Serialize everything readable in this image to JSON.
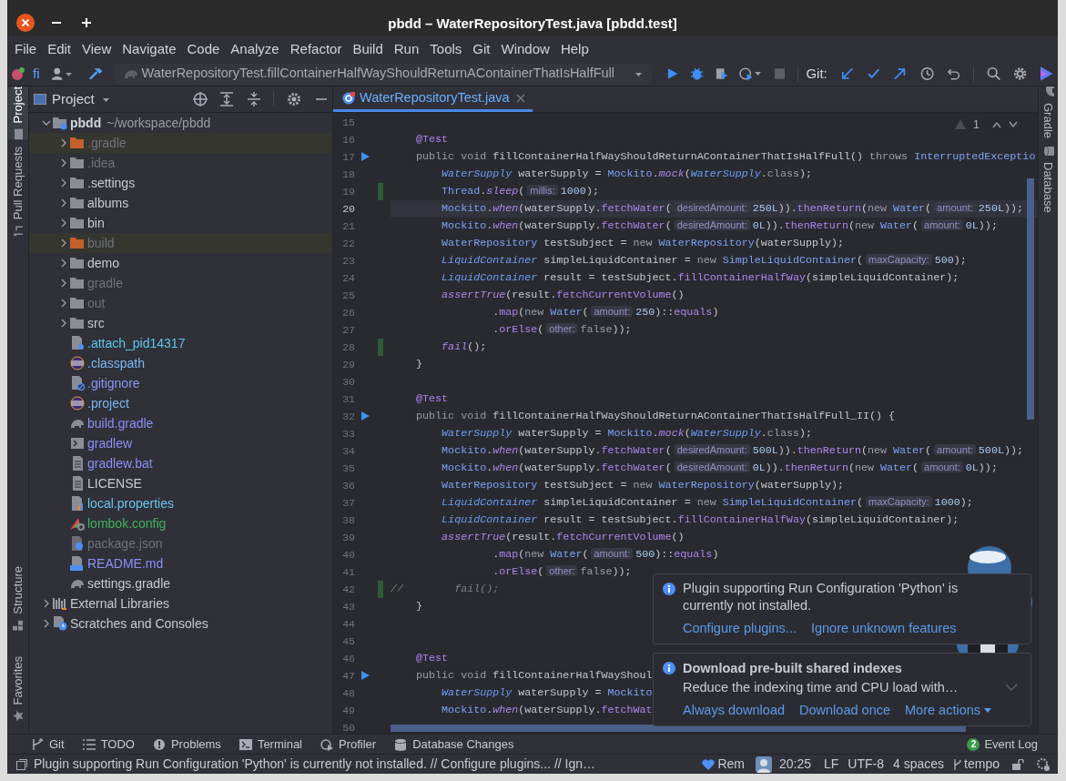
{
  "window": {
    "title": "pbdd – WaterRepositoryTest.java [pbdd.test]"
  },
  "menu": [
    "File",
    "Edit",
    "View",
    "Navigate",
    "Code",
    "Analyze",
    "Refactor",
    "Build",
    "Run",
    "Tools",
    "Git",
    "Window",
    "Help"
  ],
  "toolbar": {
    "vcs_label": "fi",
    "run_config": "WaterRepositoryTest.fillContainerHalfWayShouldReturnAContainerThatIsHalfFull",
    "git_label": "Git:"
  },
  "left_stripe": [
    {
      "label": "Project",
      "selected": true,
      "kind": "project"
    },
    {
      "label": "Pull Requests",
      "selected": false,
      "kind": "pull"
    },
    {
      "label": "Structure",
      "selected": false,
      "kind": "structure"
    },
    {
      "label": "Favorites",
      "selected": false,
      "kind": "favorites"
    }
  ],
  "right_stripe": [
    {
      "label": "Gradle",
      "kind": "gradle"
    },
    {
      "label": "Database",
      "kind": "database"
    }
  ],
  "project_panel": {
    "title": "Project",
    "tree": [
      {
        "kind": "module",
        "label": "pbdd",
        "path": "~/workspace/pbdd",
        "expanded": true,
        "children": [
          {
            "kind": "folder",
            "label": ".gradle",
            "expanded": false,
            "excluded": true,
            "color": "#6f727c"
          },
          {
            "kind": "folder",
            "label": ".idea",
            "expanded": false,
            "excluded": false,
            "color": "#6f727c"
          },
          {
            "kind": "folder",
            "label": ".settings",
            "expanded": false,
            "excluded": false,
            "color": "#c9cbd2"
          },
          {
            "kind": "folder",
            "label": "albums",
            "expanded": false,
            "excluded": false,
            "color": "#c9cbd2"
          },
          {
            "kind": "folder",
            "label": "bin",
            "expanded": false,
            "excluded": false,
            "color": "#c9cbd2"
          },
          {
            "kind": "folder",
            "label": "build",
            "expanded": false,
            "excluded": true,
            "color": "#6f727c"
          },
          {
            "kind": "folder",
            "label": "demo",
            "expanded": false,
            "excluded": false,
            "color": "#c9cbd2"
          },
          {
            "kind": "folder",
            "label": "gradle",
            "expanded": false,
            "excluded": false,
            "color": "#6f727c"
          },
          {
            "kind": "folder",
            "label": "out",
            "expanded": false,
            "excluded": false,
            "color": "#6f727c"
          },
          {
            "kind": "folder",
            "label": "src",
            "expanded": false,
            "excluded": false,
            "color": "#c9cbd2"
          },
          {
            "kind": "unknown",
            "label": ".attach_pid14317",
            "excluded": false,
            "color": "#5ec8ee"
          },
          {
            "kind": "eclipse",
            "label": ".classpath",
            "excluded": false,
            "color": "#7ab8f0"
          },
          {
            "kind": "ignore",
            "label": ".gitignore",
            "excluded": false,
            "color": "#8a98f2"
          },
          {
            "kind": "eclipse",
            "label": ".project",
            "excluded": false,
            "color": "#7ab8f0"
          },
          {
            "kind": "gradle",
            "label": "build.gradle",
            "excluded": false,
            "color": "#8c8ff5"
          },
          {
            "kind": "script",
            "label": "gradlew",
            "excluded": false,
            "color": "#8c8ff5"
          },
          {
            "kind": "text",
            "label": "gradlew.bat",
            "excluded": false,
            "color": "#8c8ff5"
          },
          {
            "kind": "text",
            "label": "LICENSE",
            "excluded": false,
            "color": "#c9cbd2"
          },
          {
            "kind": "properties",
            "label": "local.properties",
            "excluded": false,
            "color": "#6cc4f0"
          },
          {
            "kind": "config",
            "label": "lombok.config",
            "excluded": false,
            "color": "#43b05c"
          },
          {
            "kind": "json",
            "label": "package.json",
            "excluded": false,
            "color": "#6f727c"
          },
          {
            "kind": "markdown",
            "label": "README.md",
            "excluded": false,
            "color": "#8c8ff5"
          },
          {
            "kind": "gradle",
            "label": "settings.gradle",
            "excluded": false,
            "color": "#c9cbd2"
          }
        ]
      },
      {
        "kind": "libraries",
        "label": "External Libraries",
        "expanded": false
      },
      {
        "kind": "scratches",
        "label": "Scratches and Consoles",
        "expanded": false
      }
    ]
  },
  "editor": {
    "tabs": [
      {
        "label": "WaterRepositoryTest.java",
        "selected": true
      }
    ],
    "problems_count": "1",
    "lines": [
      {
        "number": "15",
        "current": false,
        "runnable": false,
        "changed": false
      },
      {
        "number": "16",
        "current": false,
        "runnable": false,
        "changed": false,
        "tokens": [
          {
            "kind": "ann",
            "text": "    @Test"
          }
        ]
      },
      {
        "number": "17",
        "current": false,
        "runnable": true,
        "changed": false,
        "tokens": [
          {
            "kind": "kw",
            "text": "    public void "
          },
          {
            "kind": "plain",
            "text": "fillContainerHalfWayShouldReturnAContainerThatIsHalfFull() "
          },
          {
            "kind": "kw",
            "text": "throws "
          },
          {
            "kind": "type",
            "text": "InterruptedExceptio"
          }
        ]
      },
      {
        "number": "18",
        "current": false,
        "runnable": false,
        "changed": false,
        "tokens": [
          {
            "kind": "itype",
            "text": "        WaterSupply"
          },
          {
            "kind": "plain",
            "text": " waterSupply = "
          },
          {
            "kind": "type",
            "text": "Mockito"
          },
          {
            "kind": "plain",
            "text": "."
          },
          {
            "kind": "icall",
            "text": "mock"
          },
          {
            "kind": "plain",
            "text": "("
          },
          {
            "kind": "itype",
            "text": "WaterSupply"
          },
          {
            "kind": "plain",
            "text": "."
          },
          {
            "kind": "kw",
            "text": "class"
          },
          {
            "kind": "plain",
            "text": ");"
          }
        ]
      },
      {
        "number": "19",
        "current": false,
        "runnable": false,
        "changed": true,
        "tokens": [
          {
            "kind": "type",
            "text": "        Thread"
          },
          {
            "kind": "plain",
            "text": "."
          },
          {
            "kind": "icall",
            "text": "sleep"
          },
          {
            "kind": "plain",
            "text": "("
          },
          {
            "kind": "hint",
            "text": "millis:"
          },
          {
            "kind": "num",
            "text": "1000"
          },
          {
            "kind": "plain",
            "text": ");"
          }
        ]
      },
      {
        "number": "20",
        "current": true,
        "runnable": false,
        "changed": false,
        "tokens": [
          {
            "kind": "type",
            "text": "        Mockito"
          },
          {
            "kind": "plain",
            "text": "."
          },
          {
            "kind": "icall",
            "text": "when"
          },
          {
            "kind": "plain",
            "text": "(waterSupply."
          },
          {
            "kind": "call",
            "text": "fetchWater"
          },
          {
            "kind": "plain",
            "text": "("
          },
          {
            "kind": "hint",
            "text": "desiredAmount:"
          },
          {
            "kind": "num",
            "text": "250L"
          },
          {
            "kind": "plain",
            "text": "))."
          },
          {
            "kind": "call",
            "text": "thenReturn"
          },
          {
            "kind": "plain",
            "text": "("
          },
          {
            "kind": "kw",
            "text": "new "
          },
          {
            "kind": "type",
            "text": "Water"
          },
          {
            "kind": "plain",
            "text": "("
          },
          {
            "kind": "hint",
            "text": "amount:"
          },
          {
            "kind": "num",
            "text": "250L"
          },
          {
            "kind": "plain",
            "text": "));"
          }
        ]
      },
      {
        "number": "21",
        "current": false,
        "runnable": false,
        "changed": false,
        "tokens": [
          {
            "kind": "type",
            "text": "        Mockito"
          },
          {
            "kind": "plain",
            "text": "."
          },
          {
            "kind": "icall",
            "text": "when"
          },
          {
            "kind": "plain",
            "text": "(waterSupply."
          },
          {
            "kind": "call",
            "text": "fetchWater"
          },
          {
            "kind": "plain",
            "text": "("
          },
          {
            "kind": "hint",
            "text": "desiredAmount:"
          },
          {
            "kind": "num",
            "text": "0L"
          },
          {
            "kind": "plain",
            "text": "))."
          },
          {
            "kind": "call",
            "text": "thenReturn"
          },
          {
            "kind": "plain",
            "text": "("
          },
          {
            "kind": "kw",
            "text": "new "
          },
          {
            "kind": "type",
            "text": "Water"
          },
          {
            "kind": "plain",
            "text": "("
          },
          {
            "kind": "hint",
            "text": "amount:"
          },
          {
            "kind": "num",
            "text": "0L"
          },
          {
            "kind": "plain",
            "text": "));"
          }
        ]
      },
      {
        "number": "22",
        "current": false,
        "runnable": false,
        "changed": false,
        "tokens": [
          {
            "kind": "type",
            "text": "        WaterRepository"
          },
          {
            "kind": "plain",
            "text": " testSubject = "
          },
          {
            "kind": "kw",
            "text": "new "
          },
          {
            "kind": "type",
            "text": "WaterRepository"
          },
          {
            "kind": "plain",
            "text": "(waterSupply);"
          }
        ]
      },
      {
        "number": "23",
        "current": false,
        "runnable": false,
        "changed": false,
        "tokens": [
          {
            "kind": "itype",
            "text": "        LiquidContainer"
          },
          {
            "kind": "plain",
            "text": " simpleLiquidContainer = "
          },
          {
            "kind": "kw",
            "text": "new "
          },
          {
            "kind": "type",
            "text": "SimpleLiquidContainer"
          },
          {
            "kind": "plain",
            "text": "("
          },
          {
            "kind": "hint",
            "text": "maxCapacity:"
          },
          {
            "kind": "num",
            "text": "500"
          },
          {
            "kind": "plain",
            "text": ");"
          }
        ]
      },
      {
        "number": "24",
        "current": false,
        "runnable": false,
        "changed": false,
        "tokens": [
          {
            "kind": "itype",
            "text": "        LiquidContainer"
          },
          {
            "kind": "plain",
            "text": " result = testSubject."
          },
          {
            "kind": "call",
            "text": "fillContainerHalfWay"
          },
          {
            "kind": "plain",
            "text": "(simpleLiquidContainer);"
          }
        ]
      },
      {
        "number": "25",
        "current": false,
        "runnable": false,
        "changed": false,
        "tokens": [
          {
            "kind": "icall",
            "text": "        assertTrue"
          },
          {
            "kind": "plain",
            "text": "(result."
          },
          {
            "kind": "call",
            "text": "fetchCurrentVolume"
          },
          {
            "kind": "plain",
            "text": "()"
          }
        ]
      },
      {
        "number": "26",
        "current": false,
        "runnable": false,
        "changed": false,
        "tokens": [
          {
            "kind": "plain",
            "text": "                ."
          },
          {
            "kind": "call",
            "text": "map"
          },
          {
            "kind": "plain",
            "text": "("
          },
          {
            "kind": "kw",
            "text": "new "
          },
          {
            "kind": "type",
            "text": "Water"
          },
          {
            "kind": "plain",
            "text": "("
          },
          {
            "kind": "hint",
            "text": "amount:"
          },
          {
            "kind": "num",
            "text": "250"
          },
          {
            "kind": "plain",
            "text": ")::"
          },
          {
            "kind": "call",
            "text": "equals"
          },
          {
            "kind": "plain",
            "text": ")"
          }
        ]
      },
      {
        "number": "27",
        "current": false,
        "runnable": false,
        "changed": false,
        "tokens": [
          {
            "kind": "plain",
            "text": "                ."
          },
          {
            "kind": "call",
            "text": "orElse"
          },
          {
            "kind": "plain",
            "text": "("
          },
          {
            "kind": "hint",
            "text": "other:"
          },
          {
            "kind": "kw",
            "text": "false"
          },
          {
            "kind": "plain",
            "text": "));"
          }
        ]
      },
      {
        "number": "28",
        "current": false,
        "runnable": false,
        "changed": true,
        "tokens": [
          {
            "kind": "icall",
            "text": "        fail"
          },
          {
            "kind": "plain",
            "text": "();"
          }
        ]
      },
      {
        "number": "29",
        "current": false,
        "runnable": false,
        "changed": false,
        "tokens": [
          {
            "kind": "plain",
            "text": "    }"
          }
        ]
      },
      {
        "number": "30",
        "current": false,
        "runnable": false,
        "changed": false
      },
      {
        "number": "31",
        "current": false,
        "runnable": false,
        "changed": false,
        "tokens": [
          {
            "kind": "ann",
            "text": "    @Test"
          }
        ]
      },
      {
        "number": "32",
        "current": false,
        "runnable": true,
        "changed": false,
        "tokens": [
          {
            "kind": "kw",
            "text": "    public void "
          },
          {
            "kind": "plain",
            "text": "fillContainerHalfWayShouldReturnAContainerThatIsHalfFull_II() {"
          }
        ]
      },
      {
        "number": "33",
        "current": false,
        "runnable": false,
        "changed": false,
        "tokens": [
          {
            "kind": "itype",
            "text": "        WaterSupply"
          },
          {
            "kind": "plain",
            "text": " waterSupply = "
          },
          {
            "kind": "type",
            "text": "Mockito"
          },
          {
            "kind": "plain",
            "text": "."
          },
          {
            "kind": "icall",
            "text": "mock"
          },
          {
            "kind": "plain",
            "text": "("
          },
          {
            "kind": "itype",
            "text": "WaterSupply"
          },
          {
            "kind": "plain",
            "text": "."
          },
          {
            "kind": "kw",
            "text": "class"
          },
          {
            "kind": "plain",
            "text": ");"
          }
        ]
      },
      {
        "number": "34",
        "current": false,
        "runnable": false,
        "changed": false,
        "tokens": [
          {
            "kind": "type",
            "text": "        Mockito"
          },
          {
            "kind": "plain",
            "text": "."
          },
          {
            "kind": "icall",
            "text": "when"
          },
          {
            "kind": "plain",
            "text": "(waterSupply."
          },
          {
            "kind": "call",
            "text": "fetchWater"
          },
          {
            "kind": "plain",
            "text": "("
          },
          {
            "kind": "hint",
            "text": "desiredAmount:"
          },
          {
            "kind": "num",
            "text": "500L"
          },
          {
            "kind": "plain",
            "text": "))."
          },
          {
            "kind": "call",
            "text": "thenReturn"
          },
          {
            "kind": "plain",
            "text": "("
          },
          {
            "kind": "kw",
            "text": "new "
          },
          {
            "kind": "type",
            "text": "Water"
          },
          {
            "kind": "plain",
            "text": "("
          },
          {
            "kind": "hint",
            "text": "amount:"
          },
          {
            "kind": "num",
            "text": "500L"
          },
          {
            "kind": "plain",
            "text": "));"
          }
        ]
      },
      {
        "number": "35",
        "current": false,
        "runnable": false,
        "changed": false,
        "tokens": [
          {
            "kind": "type",
            "text": "        Mockito"
          },
          {
            "kind": "plain",
            "text": "."
          },
          {
            "kind": "icall",
            "text": "when"
          },
          {
            "kind": "plain",
            "text": "(waterSupply."
          },
          {
            "kind": "call",
            "text": "fetchWater"
          },
          {
            "kind": "plain",
            "text": "("
          },
          {
            "kind": "hint",
            "text": "desiredAmount:"
          },
          {
            "kind": "num",
            "text": "0L"
          },
          {
            "kind": "plain",
            "text": "))."
          },
          {
            "kind": "call",
            "text": "thenReturn"
          },
          {
            "kind": "plain",
            "text": "("
          },
          {
            "kind": "kw",
            "text": "new "
          },
          {
            "kind": "type",
            "text": "Water"
          },
          {
            "kind": "plain",
            "text": "("
          },
          {
            "kind": "hint",
            "text": "amount:"
          },
          {
            "kind": "num",
            "text": "0L"
          },
          {
            "kind": "plain",
            "text": "));"
          }
        ]
      },
      {
        "number": "36",
        "current": false,
        "runnable": false,
        "changed": false,
        "tokens": [
          {
            "kind": "type",
            "text": "        WaterRepository"
          },
          {
            "kind": "plain",
            "text": " testSubject = "
          },
          {
            "kind": "kw",
            "text": "new "
          },
          {
            "kind": "type",
            "text": "WaterRepository"
          },
          {
            "kind": "plain",
            "text": "(waterSupply);"
          }
        ]
      },
      {
        "number": "37",
        "current": false,
        "runnable": false,
        "changed": false,
        "tokens": [
          {
            "kind": "itype",
            "text": "        LiquidContainer"
          },
          {
            "kind": "plain",
            "text": " simpleLiquidContainer = "
          },
          {
            "kind": "kw",
            "text": "new "
          },
          {
            "kind": "type",
            "text": "SimpleLiquidContainer"
          },
          {
            "kind": "plain",
            "text": "("
          },
          {
            "kind": "hint",
            "text": "maxCapacity:"
          },
          {
            "kind": "num",
            "text": "1000"
          },
          {
            "kind": "plain",
            "text": ");"
          }
        ]
      },
      {
        "number": "38",
        "current": false,
        "runnable": false,
        "changed": false,
        "tokens": [
          {
            "kind": "itype",
            "text": "        LiquidContainer"
          },
          {
            "kind": "plain",
            "text": " result = testSubject."
          },
          {
            "kind": "call",
            "text": "fillContainerHalfWay"
          },
          {
            "kind": "plain",
            "text": "(simpleLiquidContainer);"
          }
        ]
      },
      {
        "number": "39",
        "current": false,
        "runnable": false,
        "changed": false,
        "tokens": [
          {
            "kind": "icall",
            "text": "        assertTrue"
          },
          {
            "kind": "plain",
            "text": "(result."
          },
          {
            "kind": "call",
            "text": "fetchCurrentVolume"
          },
          {
            "kind": "plain",
            "text": "()"
          }
        ]
      },
      {
        "number": "40",
        "current": false,
        "runnable": false,
        "changed": false,
        "tokens": [
          {
            "kind": "plain",
            "text": "                ."
          },
          {
            "kind": "call",
            "text": "map"
          },
          {
            "kind": "plain",
            "text": "("
          },
          {
            "kind": "kw",
            "text": "new "
          },
          {
            "kind": "type",
            "text": "Water"
          },
          {
            "kind": "plain",
            "text": "("
          },
          {
            "kind": "hint",
            "text": "amount:"
          },
          {
            "kind": "num",
            "text": "500"
          },
          {
            "kind": "plain",
            "text": ")::"
          },
          {
            "kind": "call",
            "text": "equals"
          },
          {
            "kind": "plain",
            "text": ")"
          }
        ]
      },
      {
        "number": "41",
        "current": false,
        "runnable": false,
        "changed": false,
        "tokens": [
          {
            "kind": "plain",
            "text": "                ."
          },
          {
            "kind": "call",
            "text": "orElse"
          },
          {
            "kind": "plain",
            "text": "("
          },
          {
            "kind": "hint",
            "text": "other:"
          },
          {
            "kind": "kw",
            "text": "false"
          },
          {
            "kind": "plain",
            "text": "));"
          }
        ]
      },
      {
        "number": "42",
        "current": false,
        "runnable": false,
        "changed": true,
        "tokens": [
          {
            "kind": "comment",
            "text": "//        fail();"
          }
        ]
      },
      {
        "number": "43",
        "current": false,
        "runnable": false,
        "changed": false,
        "tokens": [
          {
            "kind": "plain",
            "text": "    }"
          }
        ]
      },
      {
        "number": "44",
        "current": false,
        "runnable": false,
        "changed": false
      },
      {
        "number": "45",
        "current": false,
        "runnable": false,
        "changed": false
      },
      {
        "number": "46",
        "current": false,
        "runnable": false,
        "changed": false,
        "tokens": [
          {
            "kind": "ann",
            "text": "    @Test"
          }
        ]
      },
      {
        "number": "47",
        "current": false,
        "runnable": true,
        "changed": false,
        "tokens": [
          {
            "kind": "kw",
            "text": "    public void "
          },
          {
            "kind": "plain",
            "text": "fillContainerHalfWayShoul"
          }
        ]
      },
      {
        "number": "48",
        "current": false,
        "runnable": false,
        "changed": false,
        "tokens": [
          {
            "kind": "itype",
            "text": "        WaterSupply"
          },
          {
            "kind": "plain",
            "text": " waterSupply = "
          },
          {
            "kind": "type",
            "text": "Mockito"
          }
        ]
      },
      {
        "number": "49",
        "current": false,
        "runnable": false,
        "changed": false,
        "tokens": [
          {
            "kind": "type",
            "text": "        Mockito"
          },
          {
            "kind": "plain",
            "text": "."
          },
          {
            "kind": "icall",
            "text": "when"
          },
          {
            "kind": "plain",
            "text": "(waterSupply."
          },
          {
            "kind": "call",
            "text": "fetchWat"
          }
        ]
      },
      {
        "number": "50",
        "current": false,
        "runnable": false,
        "changed": false
      }
    ]
  },
  "notifications": [
    {
      "body": "Plugin supporting Run Configuration 'Python' is currently not installed.",
      "actions": [
        {
          "label": "Configure plugins...",
          "dropdown": false
        },
        {
          "label": "Ignore unknown features",
          "dropdown": false
        }
      ],
      "expandable": false
    },
    {
      "title": "Download pre-built shared indexes",
      "body": "Reduce the indexing time and CPU load with…",
      "actions": [
        {
          "label": "Always download",
          "dropdown": false
        },
        {
          "label": "Download once",
          "dropdown": false
        },
        {
          "label": "More actions",
          "dropdown": true
        }
      ],
      "expandable": true
    }
  ],
  "tool_windows": [
    {
      "label": "Git",
      "kind": "git"
    },
    {
      "label": "TODO",
      "kind": "todo"
    },
    {
      "label": "Problems",
      "kind": "problems"
    },
    {
      "label": "Terminal",
      "kind": "terminal"
    },
    {
      "label": "Profiler",
      "kind": "profiler"
    },
    {
      "label": "Database Changes",
      "kind": "database"
    }
  ],
  "event_log": {
    "label": "Event Log",
    "count": "2"
  },
  "status_bar": {
    "message": "Plugin supporting Run Configuration 'Python' is currently not installed. // Configure plugins... // Ign…",
    "remote": "Rem",
    "position": "20:25",
    "line_separator": "LF",
    "encoding": "UTF-8",
    "indent": "4 spaces",
    "branch": "tempo"
  }
}
